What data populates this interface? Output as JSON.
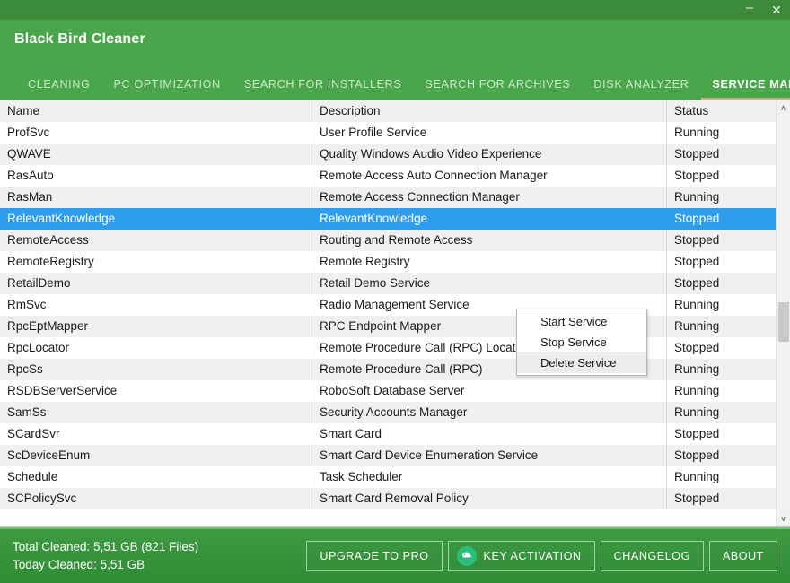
{
  "window": {
    "title": "Black Bird Cleaner",
    "minimize_label": "–",
    "close_label": "✕",
    "accent_green": "#4aa64a",
    "titlebar_green": "#3c8c3c",
    "active_tab_underline": "#f59b8a",
    "selection_blue": "#2f9ded"
  },
  "tabs": [
    {
      "label": "CLEANING",
      "active": false
    },
    {
      "label": "PC OPTIMIZATION",
      "active": false
    },
    {
      "label": "SEARCH FOR INSTALLERS",
      "active": false
    },
    {
      "label": "SEARCH FOR ARCHIVES",
      "active": false
    },
    {
      "label": "DISK ANALYZER",
      "active": false
    },
    {
      "label": "SERVICE MANAGER",
      "active": true
    }
  ],
  "table": {
    "columns": [
      "Name",
      "Description",
      "Status"
    ],
    "rows": [
      {
        "name": "Name",
        "description": "Description",
        "status": "Status",
        "header": true,
        "selected": false
      },
      {
        "name": "ProfSvc",
        "description": "User Profile Service",
        "status": "Running",
        "header": false,
        "selected": false
      },
      {
        "name": "QWAVE",
        "description": "Quality Windows Audio Video Experience",
        "status": "Stopped",
        "header": false,
        "selected": false
      },
      {
        "name": "RasAuto",
        "description": "Remote Access Auto Connection Manager",
        "status": "Stopped",
        "header": false,
        "selected": false
      },
      {
        "name": "RasMan",
        "description": "Remote Access Connection Manager",
        "status": "Running",
        "header": false,
        "selected": false
      },
      {
        "name": "RelevantKnowledge",
        "description": "RelevantKnowledge",
        "status": "Stopped",
        "header": false,
        "selected": true
      },
      {
        "name": "RemoteAccess",
        "description": "Routing and Remote Access",
        "status": "Stopped",
        "header": false,
        "selected": false
      },
      {
        "name": "RemoteRegistry",
        "description": "Remote Registry",
        "status": "Stopped",
        "header": false,
        "selected": false
      },
      {
        "name": "RetailDemo",
        "description": "Retail Demo Service",
        "status": "Stopped",
        "header": false,
        "selected": false
      },
      {
        "name": "RmSvc",
        "description": "Radio Management Service",
        "status": "Running",
        "header": false,
        "selected": false
      },
      {
        "name": "RpcEptMapper",
        "description": "RPC Endpoint Mapper",
        "status": "Running",
        "header": false,
        "selected": false
      },
      {
        "name": "RpcLocator",
        "description": "Remote Procedure Call (RPC) Locator",
        "status": "Stopped",
        "header": false,
        "selected": false
      },
      {
        "name": "RpcSs",
        "description": "Remote Procedure Call (RPC)",
        "status": "Running",
        "header": false,
        "selected": false
      },
      {
        "name": "RSDBServerService",
        "description": "RoboSoft Database Server",
        "status": "Running",
        "header": false,
        "selected": false
      },
      {
        "name": "SamSs",
        "description": "Security Accounts Manager",
        "status": "Running",
        "header": false,
        "selected": false
      },
      {
        "name": "SCardSvr",
        "description": "Smart Card",
        "status": "Stopped",
        "header": false,
        "selected": false
      },
      {
        "name": "ScDeviceEnum",
        "description": "Smart Card Device Enumeration Service",
        "status": "Stopped",
        "header": false,
        "selected": false
      },
      {
        "name": "Schedule",
        "description": "Task Scheduler",
        "status": "Running",
        "header": false,
        "selected": false
      },
      {
        "name": "SCPolicySvc",
        "description": "Smart Card Removal Policy",
        "status": "Stopped",
        "header": false,
        "selected": false
      }
    ]
  },
  "context_menu": {
    "items": [
      {
        "label": "Start Service",
        "hover": false
      },
      {
        "label": "Stop Service",
        "hover": false
      },
      {
        "label": "Delete Service",
        "hover": true
      }
    ]
  },
  "scrollbar": {
    "up_arrow": "∧",
    "down_arrow": "∨"
  },
  "footer": {
    "total_cleaned": "Total Cleaned: 5,51 GB (821 Files)",
    "today_cleaned": "Today Cleaned: 5,51 GB",
    "buttons": [
      {
        "label": "UPGRADE TO PRO",
        "icon": null
      },
      {
        "label": "KEY ACTIVATION",
        "icon": "key-icon"
      },
      {
        "label": "CHANGELOG",
        "icon": null
      },
      {
        "label": "ABOUT",
        "icon": null
      }
    ]
  }
}
